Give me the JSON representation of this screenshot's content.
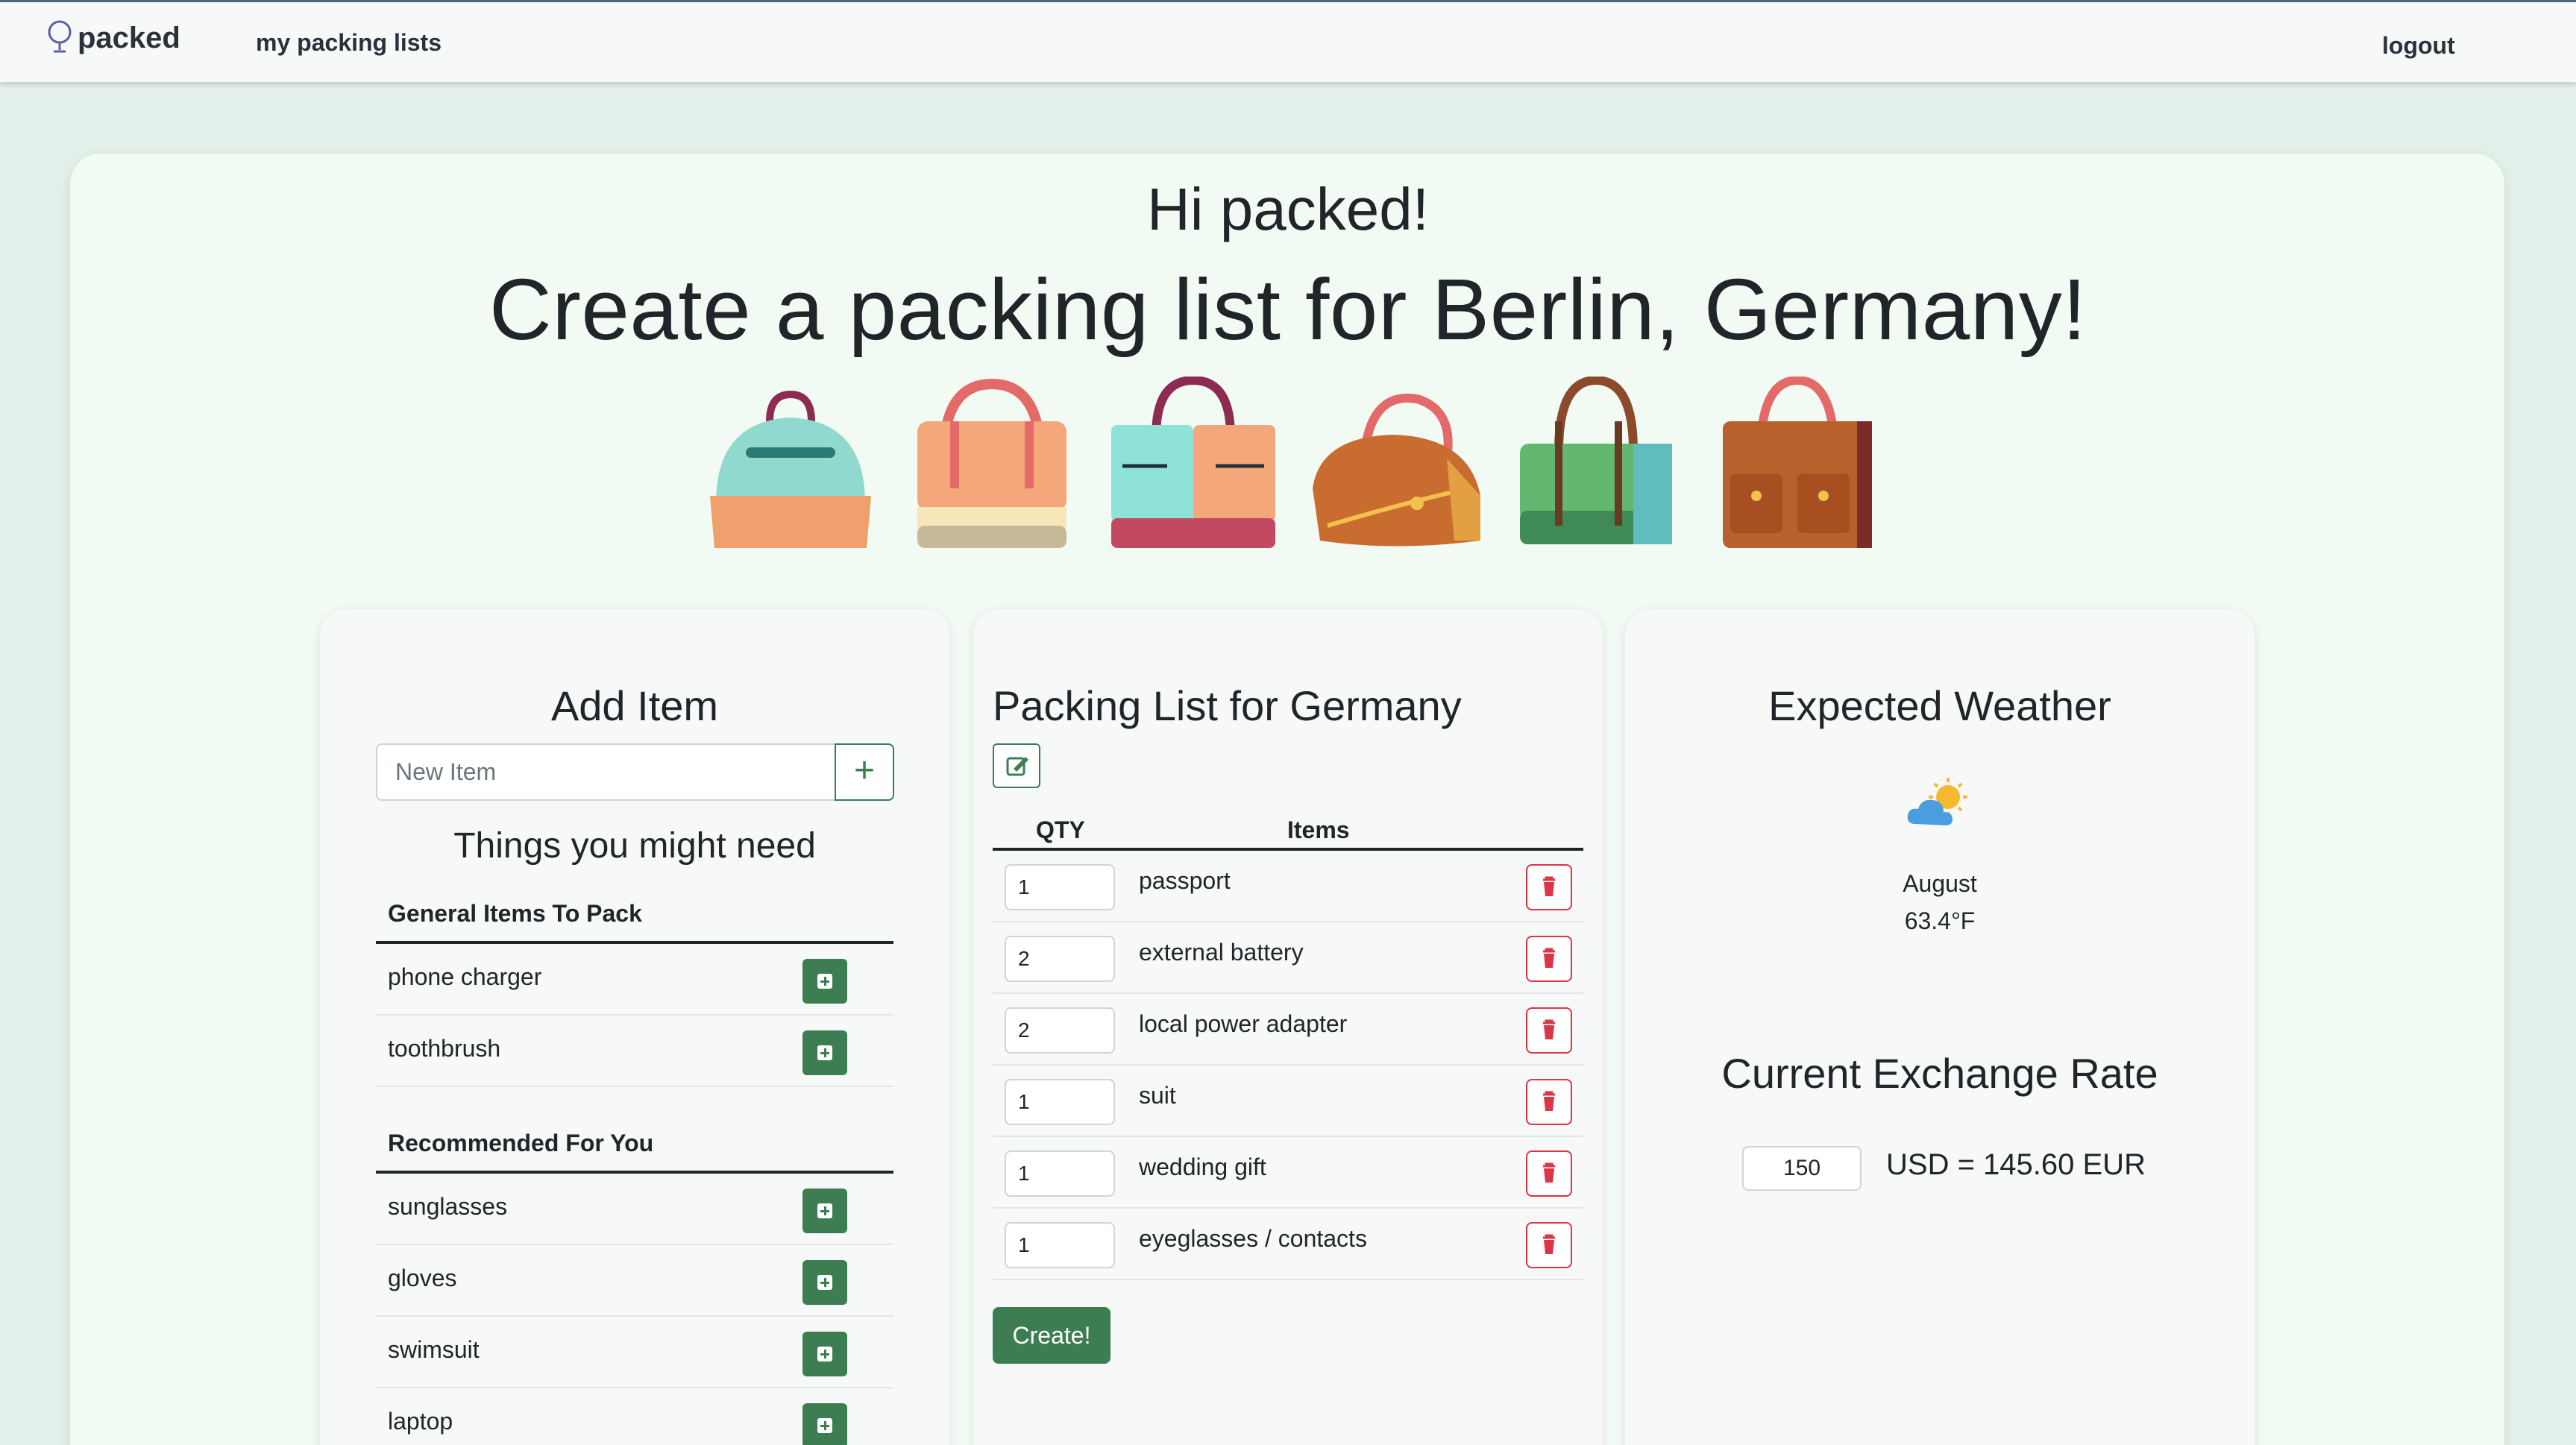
{
  "nav": {
    "brand": "packed",
    "my_lists": "my packing lists",
    "logout": "logout"
  },
  "hero": {
    "greeting": "Hi packed!",
    "headline": "Create a packing list for Berlin, Germany!"
  },
  "add_item": {
    "title": "Add Item",
    "placeholder": "New Item",
    "add_button": "+",
    "suggestions_title": "Things you might need",
    "general_heading": "General Items To Pack",
    "general_items": [
      "phone charger",
      "toothbrush"
    ],
    "recommended_heading": "Recommended For You",
    "recommended_items": [
      "sunglasses",
      "gloves",
      "swimsuit",
      "laptop"
    ]
  },
  "packing_list": {
    "title": "Packing List for Germany",
    "col_qty": "QTY",
    "col_items": "Items",
    "rows": [
      {
        "qty": "1",
        "item": "passport"
      },
      {
        "qty": "2",
        "item": "external battery"
      },
      {
        "qty": "2",
        "item": "local power adapter"
      },
      {
        "qty": "1",
        "item": "suit"
      },
      {
        "qty": "1",
        "item": "wedding gift"
      },
      {
        "qty": "1",
        "item": "eyeglasses / contacts"
      }
    ],
    "create_button": "Create!"
  },
  "weather": {
    "title": "Expected Weather",
    "icon": "partly-sunny-icon",
    "month": "August",
    "temp": "63.4°F"
  },
  "exchange": {
    "title": "Current Exchange Rate",
    "amount": "150",
    "result": "USD = 145.60 EUR"
  },
  "colors": {
    "background": "#e3f1ea",
    "card": "#f1fbf4",
    "accent_green": "#3c7d52",
    "danger_red": "#dc3545"
  }
}
